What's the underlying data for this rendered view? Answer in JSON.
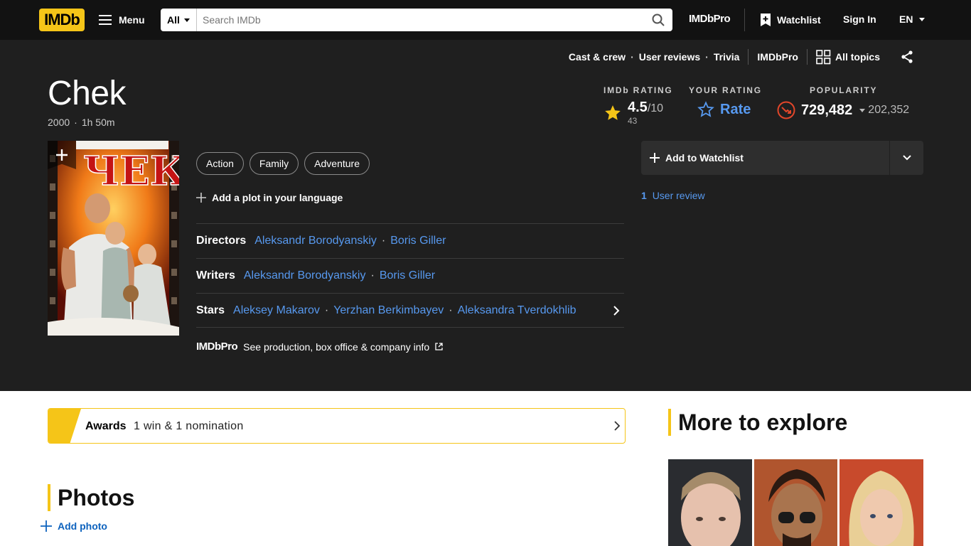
{
  "nav": {
    "logo": "IMDb",
    "menu_label": "Menu",
    "search_category": "All",
    "search_placeholder": "Search IMDb",
    "imdbpro": "IMDbPro",
    "watchlist": "Watchlist",
    "signin": "Sign In",
    "language": "EN"
  },
  "subnav": {
    "items": [
      "Cast & crew",
      "User reviews",
      "Trivia"
    ],
    "imdbpro": "IMDbPro",
    "all_topics": "All topics"
  },
  "title": {
    "name": "Chek",
    "year": "2000",
    "runtime": "1h 50m"
  },
  "ratings": {
    "imdb_label": "IMDb RATING",
    "imdb_score": "4.5",
    "imdb_scale": "/10",
    "imdb_votes": "43",
    "your_label": "YOUR RATING",
    "rate": "Rate",
    "pop_label": "POPULARITY",
    "pop_rank": "729,482",
    "pop_delta": "202,352"
  },
  "poster": {
    "title_text": "ЧЕК"
  },
  "genres": [
    "Action",
    "Family",
    "Adventure"
  ],
  "plot_add": "Add a plot in your language",
  "credits": {
    "directors_label": "Directors",
    "directors": [
      "Aleksandr Borodyanskiy",
      "Boris Giller"
    ],
    "writers_label": "Writers",
    "writers": [
      "Aleksandr Borodyanskiy",
      "Boris Giller"
    ],
    "stars_label": "Stars",
    "stars": [
      "Aleksey Makarov",
      "Yerzhan Berkimbayev",
      "Aleksandra Tverdokhlib"
    ]
  },
  "pro_link": {
    "logo": "IMDbPro",
    "text": "See production, box office & company info"
  },
  "watchlist_button": "Add to Watchlist",
  "user_review": {
    "count": "1",
    "label": "User review"
  },
  "awards": {
    "label": "Awards",
    "text": "1 win & 1 nomination"
  },
  "photos": {
    "title": "Photos",
    "add": "Add photo"
  },
  "explore": {
    "title": "More to explore"
  },
  "colors": {
    "imdb_yellow": "#f5c518",
    "link_blue": "#5799ef",
    "hero_bg": "#1f1f1f",
    "nav_bg": "#121212",
    "popularity_red": "#e2462a"
  },
  "icons": [
    "hamburger-icon",
    "search-icon",
    "watchlist-icon",
    "caret-down-icon",
    "all-topics-icon",
    "share-icon",
    "star-icon",
    "star-outline-icon",
    "popularity-icon",
    "plus-icon",
    "chevron-right-icon",
    "external-link-icon",
    "chevron-down-icon"
  ]
}
